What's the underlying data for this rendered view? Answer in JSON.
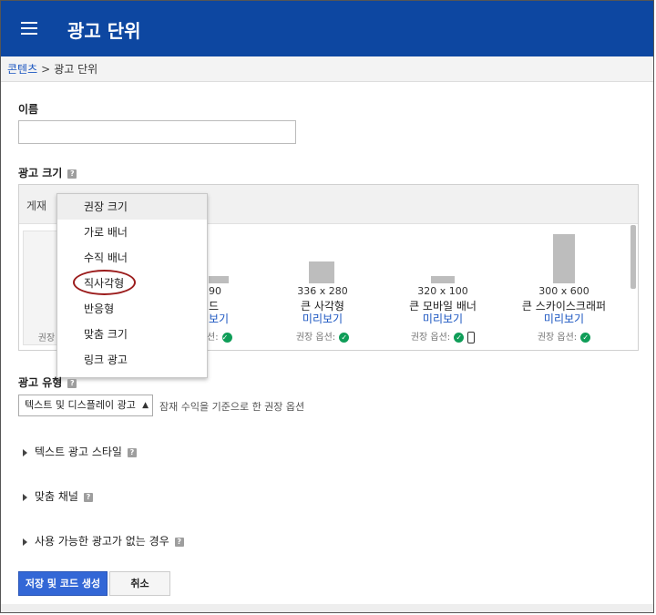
{
  "header": {
    "title": "광고 단위"
  },
  "breadcrumb": {
    "parent": "콘텐츠",
    "separator": ">",
    "current": "광고 단위"
  },
  "form": {
    "name_label": "이름",
    "name_value": "",
    "ad_size_label": "광고 크기",
    "panel_label": "게재",
    "help_glyph": "?",
    "ad_type_label": "광고 유형",
    "ad_type_value": "텍스트 및 디스플레이 광고",
    "ad_type_note": "잠재 수익을 기준으로 한 권장 옵션"
  },
  "dropdown": {
    "items": [
      "권장 크기",
      "가로 배너",
      "수직 배너",
      "직사각형",
      "반응형",
      "맞춤 크기",
      "링크 광고"
    ],
    "highlighted_index": 0,
    "circled_index": 3
  },
  "ad_sizes": [
    {
      "dims": "",
      "name": "",
      "preview": "",
      "rec": "권장"
    },
    {
      "dims": "90",
      "name": "드",
      "preview": "보기",
      "rec": "션:"
    },
    {
      "dims": "336 x 280",
      "name": "큰 사각형",
      "preview": "미리보기",
      "rec": "권장 옵션:"
    },
    {
      "dims": "320 x 100",
      "name": "큰 모바일 배너",
      "preview": "미리보기",
      "rec": "권장 옵션:"
    },
    {
      "dims": "300 x 600",
      "name": "큰 스카이스크래퍼",
      "preview": "미리보기",
      "rec": "권장 옵션:"
    }
  ],
  "sections": [
    "텍스트 광고 스타일",
    "맞춤 채널",
    "사용 가능한 광고가 없는 경우"
  ],
  "buttons": {
    "save": "저장 및 코드 생성",
    "cancel": "취소"
  },
  "colors": {
    "header": "#0d47a1",
    "primary_button": "#3367d6",
    "link": "#1a55c0",
    "check": "#0f9d58",
    "circle": "#9b1c1c"
  }
}
